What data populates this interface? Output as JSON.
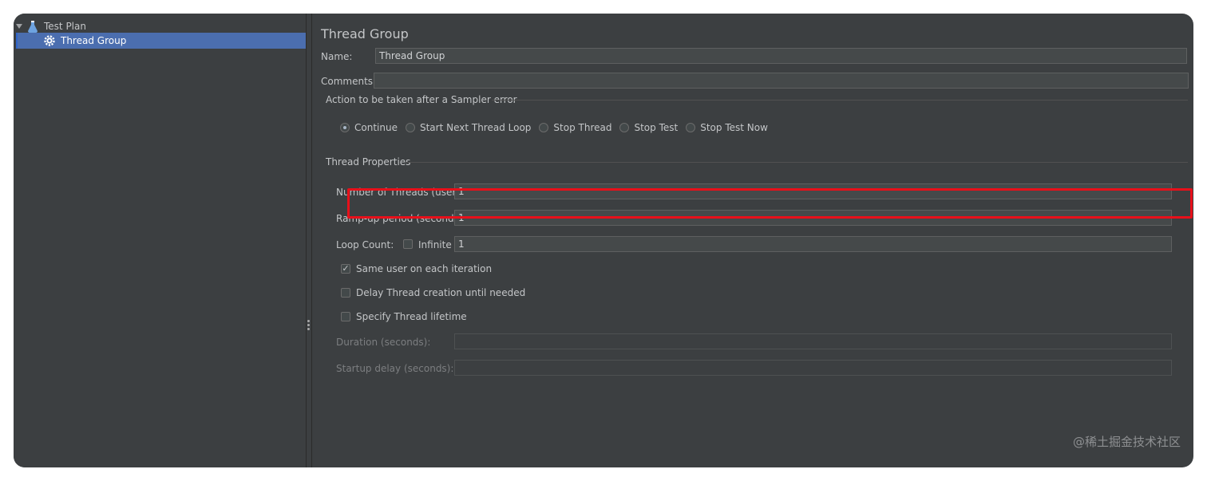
{
  "tree": {
    "items": [
      {
        "label": "Test Plan"
      },
      {
        "label": "Thread Group"
      }
    ]
  },
  "panel": {
    "title": "Thread Group",
    "name_label": "Name:",
    "name_value": "Thread Group",
    "comments_label": "Comments:",
    "comments_value": "",
    "sampler_error": {
      "heading": "Action to be taken after a Sampler error",
      "options": [
        "Continue",
        "Start Next Thread Loop",
        "Stop Thread",
        "Stop Test",
        "Stop Test Now"
      ],
      "selected": "Continue"
    },
    "thread_props": {
      "heading": "Thread Properties",
      "num_threads_label": "Number of Threads (users):",
      "num_threads_value": "1",
      "rampup_label": "Ramp-up period (seconds):",
      "rampup_value": "1",
      "loop_label": "Loop Count:",
      "infinite_label": "Infinite",
      "loop_value": "1",
      "same_user_label": "Same user on each iteration",
      "delay_label": "Delay Thread creation until needed",
      "lifetime_label": "Specify Thread lifetime",
      "duration_label": "Duration (seconds):",
      "startup_label": "Startup delay (seconds):"
    }
  },
  "watermark": "@稀土掘金技术社区",
  "colors": {
    "highlight": "#e8101a",
    "selection": "#4b6eaf",
    "background": "#3c3f41"
  }
}
